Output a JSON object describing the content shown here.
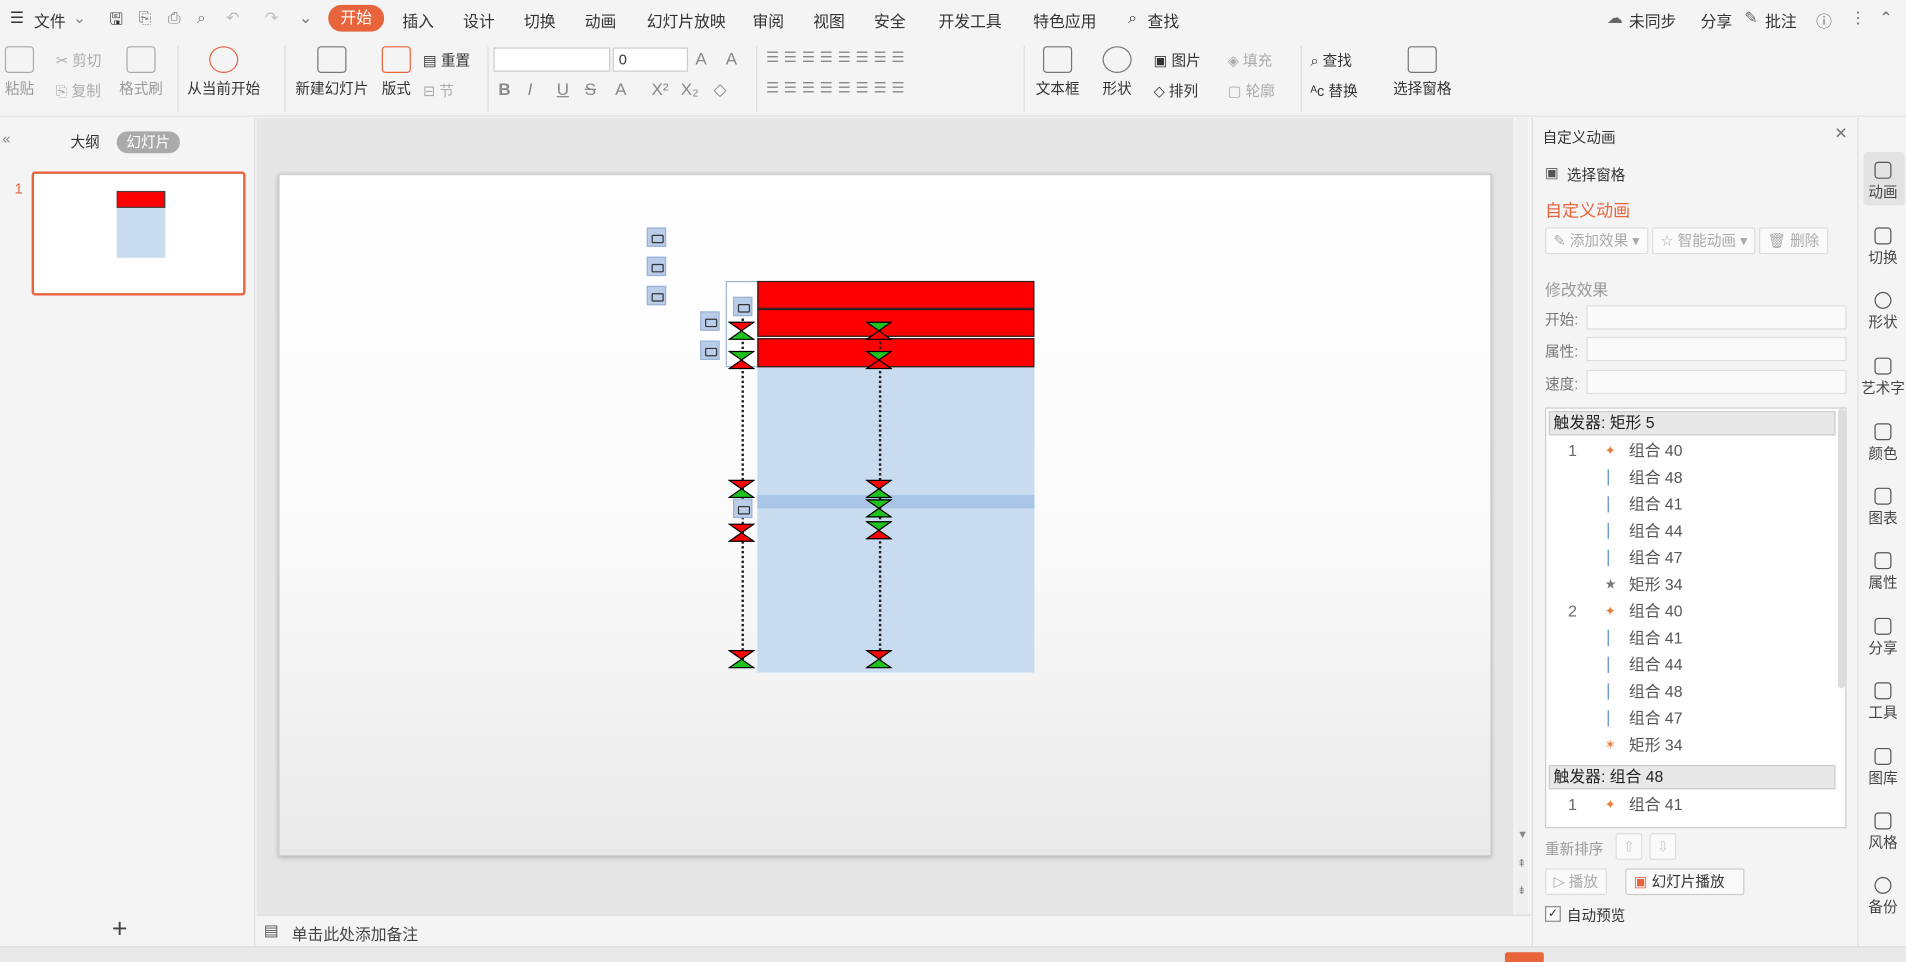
{
  "menu": {
    "file": "文件",
    "tabs": [
      "开始",
      "插入",
      "设计",
      "切换",
      "动画",
      "幻灯片放映",
      "审阅",
      "视图",
      "安全",
      "开发工具",
      "特色应用"
    ],
    "search": "查找",
    "sync": "未同步",
    "share": "分享",
    "comment": "批注"
  },
  "ribbon": {
    "paste": "粘贴",
    "cut": "剪切",
    "copy": "复制",
    "format_painter": "格式刷",
    "from_current": "从当前开始",
    "new_slide": "新建幻灯片",
    "layout": "版式",
    "reset": "重置",
    "section": "节",
    "font_size": "0",
    "textbox": "文本框",
    "shape": "形状",
    "picture": "图片",
    "fill": "填充",
    "arrange": "排列",
    "outline": "轮廓",
    "find": "查找",
    "replace": "替换",
    "select_pane": "选择窗格"
  },
  "left": {
    "outline_tab": "大纲",
    "slides_tab": "幻灯片",
    "slide_number": "1",
    "add": "+"
  },
  "notes": {
    "placeholder": "单击此处添加备注"
  },
  "anim_panel": {
    "header": "自定义动画",
    "select_pane": "选择窗格",
    "title": "自定义动画",
    "add_effect": "添加效果",
    "smart_anim": "智能动画",
    "delete": "删除",
    "modify": "修改效果",
    "start_label": "开始:",
    "prop_label": "属性:",
    "speed_label": "速度:",
    "reorder": "重新排序",
    "play": "播放",
    "slideshow": "幻灯片播放",
    "auto_preview": "自动预览",
    "groups": [
      {
        "trigger": "触发器: 矩形 5",
        "items": [
          {
            "num": "1",
            "name": "组合 40"
          },
          {
            "num": "",
            "name": "组合 48"
          },
          {
            "num": "",
            "name": "组合 41"
          },
          {
            "num": "",
            "name": "组合 44"
          },
          {
            "num": "",
            "name": "组合 47"
          },
          {
            "num": "",
            "name": "矩形 34"
          },
          {
            "num": "2",
            "name": "组合 40"
          },
          {
            "num": "",
            "name": "组合 41"
          },
          {
            "num": "",
            "name": "组合 44"
          },
          {
            "num": "",
            "name": "组合 48"
          },
          {
            "num": "",
            "name": "组合 47"
          },
          {
            "num": "",
            "name": "矩形 34"
          }
        ]
      },
      {
        "trigger": "触发器: 组合 48",
        "items": [
          {
            "num": "1",
            "name": "组合 41"
          }
        ]
      }
    ]
  },
  "vtools": [
    "动画",
    "切换",
    "形状",
    "艺术字",
    "颜色",
    "图表",
    "属性",
    "分享",
    "工具",
    "图库",
    "风格",
    "备份"
  ],
  "colors": {
    "accent": "#e8643c",
    "red_bar": "#ff0000",
    "table_fill": "#c9dbee",
    "green": "#1fc21f"
  }
}
